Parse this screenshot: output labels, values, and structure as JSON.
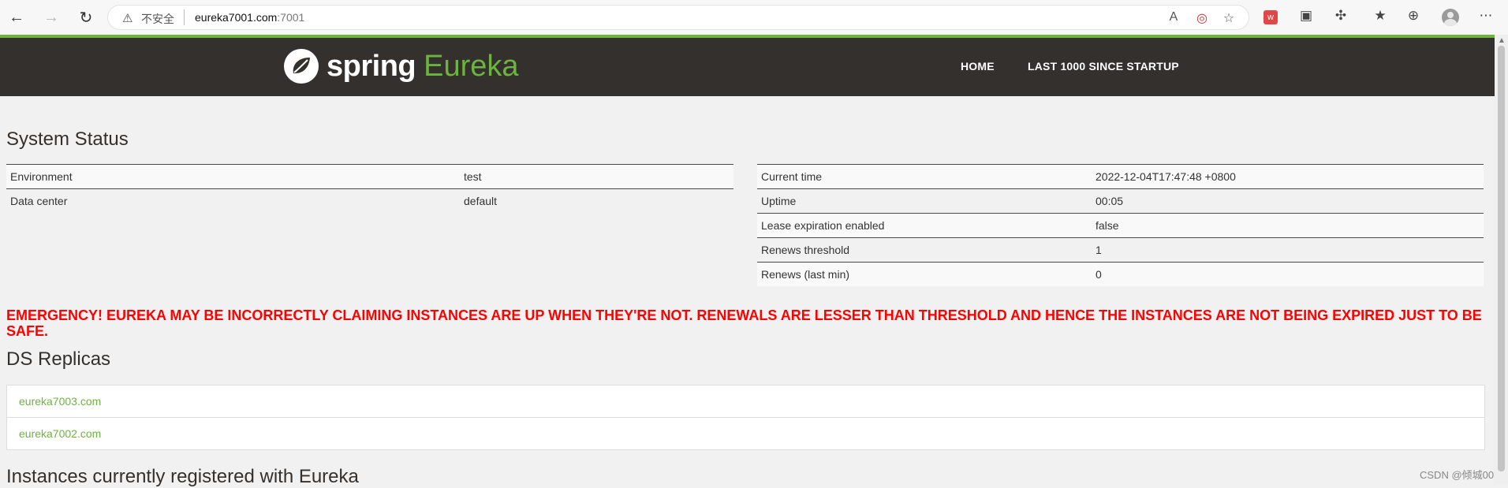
{
  "browser": {
    "insecure_label": "不安全",
    "url_host": "eureka7001.com",
    "url_port": ":7001",
    "back_glyph": "←",
    "forward_glyph": "→",
    "reload_glyph": "↻",
    "warn_glyph": "⚠",
    "read_aloud_glyph": "A",
    "tracking_glyph": "◎",
    "favorite_glyph": "☆",
    "ext_red_glyph": "ᴡ",
    "collections_glyph": "▣",
    "extensions_glyph": "✣",
    "favorites_bar_glyph": "★",
    "add_collection_glyph": "⊕",
    "menu_glyph": "⋯"
  },
  "header": {
    "logo_spring": "spring",
    "logo_eureka": "Eureka",
    "nav": [
      "HOME",
      "LAST 1000 SINCE STARTUP"
    ]
  },
  "system_status": {
    "title": "System Status",
    "left_table": [
      {
        "label": "Environment",
        "value": "test"
      },
      {
        "label": "Data center",
        "value": "default"
      }
    ],
    "right_table": [
      {
        "label": "Current time",
        "value": "2022-12-04T17:47:48 +0800"
      },
      {
        "label": "Uptime",
        "value": "00:05"
      },
      {
        "label": "Lease expiration enabled",
        "value": "false"
      },
      {
        "label": "Renews threshold",
        "value": "1"
      },
      {
        "label": "Renews (last min)",
        "value": "0"
      }
    ]
  },
  "emergency": "EMERGENCY! EUREKA MAY BE INCORRECTLY CLAIMING INSTANCES ARE UP WHEN THEY'RE NOT. RENEWALS ARE LESSER THAN THRESHOLD AND HENCE THE INSTANCES ARE NOT BEING EXPIRED JUST TO BE SAFE.",
  "ds_replicas": {
    "title": "DS Replicas",
    "items": [
      "eureka7003.com",
      "eureka7002.com"
    ]
  },
  "instances_title": "Instances currently registered with Eureka",
  "watermark": "CSDN @倾城00",
  "colors": {
    "accent_green": "#6db33f",
    "header_dark": "#34302d",
    "emergency_red": "#ff0000"
  }
}
